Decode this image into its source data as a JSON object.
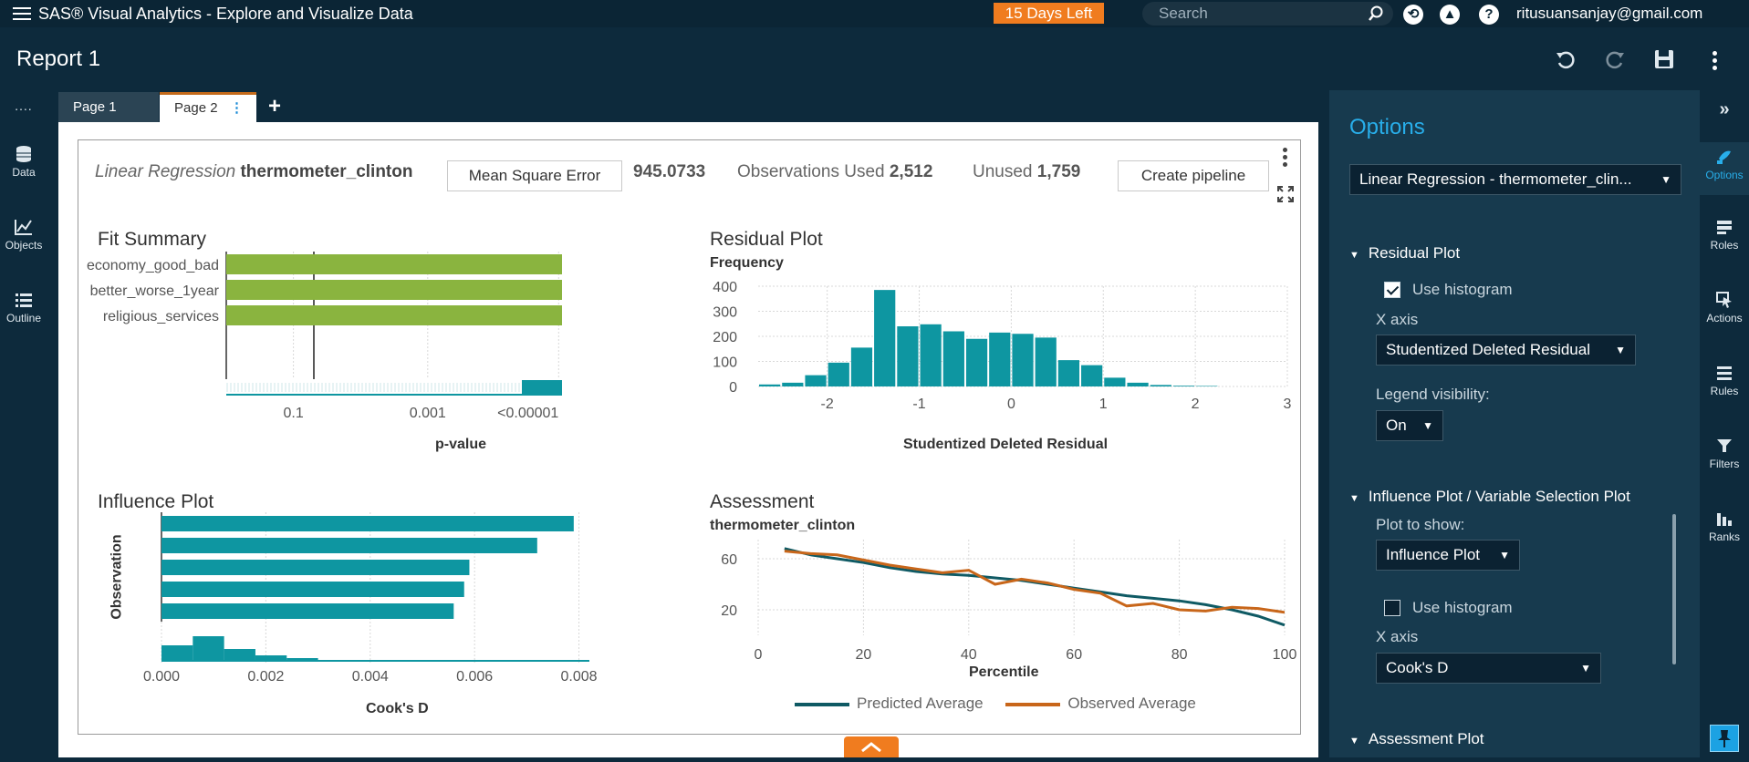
{
  "app": {
    "title": "SAS® Visual Analytics - Explore and Visualize Data",
    "trial_badge": "15 Days Left",
    "search_placeholder": "Search",
    "user_email": "ritusuansanjay@gmail.com",
    "help_icon": "?"
  },
  "report": {
    "title": "Report 1"
  },
  "left_rail": [
    {
      "label": "Data",
      "icon": "database-icon"
    },
    {
      "label": "Objects",
      "icon": "chart-line-icon"
    },
    {
      "label": "Outline",
      "icon": "list-icon"
    }
  ],
  "tabs": [
    {
      "label": "Page 1",
      "active": false
    },
    {
      "label": "Page 2",
      "active": true
    }
  ],
  "tab_add": "+",
  "object": {
    "model_type": "Linear Regression",
    "response": "thermometer_clinton",
    "metric_button": "Mean Square Error",
    "metric_value": "945.0733",
    "obs_used_label": "Observations Used",
    "obs_used_value": "2,512",
    "unused_label": "Unused",
    "unused_value": "1,759",
    "create_pipeline": "Create pipeline"
  },
  "fit_summary": {
    "title": "Fit Summary",
    "x_axis_title": "p-value",
    "variables": [
      "economy_good_bad",
      "better_worse_1year",
      "religious_services"
    ],
    "ticks": [
      "0.1",
      "0.001",
      "<0.00001"
    ],
    "bar_fraction": [
      1.0,
      1.0,
      1.0
    ]
  },
  "residual_plot": {
    "title": "Residual Plot",
    "y_label": "Frequency",
    "x_axis_title": "Studentized Deleted Residual",
    "x_ticks": [
      "-2",
      "-1",
      "0",
      "1",
      "2",
      "3"
    ],
    "y_ticks": [
      "400",
      "300",
      "200",
      "100",
      "0"
    ]
  },
  "influence_plot": {
    "title": "Influence Plot",
    "y_axis_title": "Observation",
    "x_axis_title": "Cook's D",
    "x_ticks": [
      "0.000",
      "0.002",
      "0.004",
      "0.006",
      "0.008"
    ]
  },
  "assessment": {
    "title": "Assessment",
    "subtitle": "thermometer_clinton",
    "x_axis_title": "Percentile",
    "x_ticks": [
      "0",
      "20",
      "40",
      "60",
      "80",
      "100"
    ],
    "y_ticks": [
      "60",
      "20"
    ],
    "legend": [
      "Predicted Average",
      "Observed Average"
    ],
    "colors": {
      "predicted": "#0f5a64",
      "observed": "#c8661a"
    }
  },
  "options": {
    "title": "Options",
    "object_select": "Linear Regression - thermometer_clin...",
    "residual_section": "Residual Plot",
    "use_histogram_1": "Use histogram",
    "x_axis_label_1": "X axis",
    "x_axis_value_1": "Studentized Deleted Residual",
    "legend_label": "Legend visibility:",
    "legend_value": "On",
    "influence_section": "Influence Plot / Variable Selection Plot",
    "plot_to_show_label": "Plot to show:",
    "plot_to_show_value": "Influence Plot",
    "use_histogram_2": "Use histogram",
    "x_axis_label_2": "X axis",
    "x_axis_value_2": "Cook's D",
    "assessment_section": "Assessment Plot"
  },
  "right_rail": [
    {
      "label": "Options",
      "icon": "brush-icon",
      "active": true
    },
    {
      "label": "Roles",
      "icon": "roles-icon",
      "active": false
    },
    {
      "label": "Actions",
      "icon": "cursor-icon",
      "active": false
    },
    {
      "label": "Rules",
      "icon": "rules-icon",
      "active": false
    },
    {
      "label": "Filters",
      "icon": "filter-icon",
      "active": false
    },
    {
      "label": "Ranks",
      "icon": "ranks-icon",
      "active": false
    }
  ],
  "chart_data": [
    {
      "type": "bar",
      "title": "Fit Summary",
      "xlabel": "p-value",
      "categories": [
        "economy_good_bad",
        "better_worse_1year",
        "religious_services"
      ],
      "values": [
        1e-06,
        1e-06,
        1e-06
      ],
      "xscale": "log",
      "x_ticks": [
        "0.1",
        "0.001",
        "<0.00001"
      ]
    },
    {
      "type": "bar",
      "title": "Residual Plot",
      "xlabel": "Studentized Deleted Residual",
      "ylabel": "Frequency",
      "bin_start": -2.75,
      "bin_width": 0.25,
      "values": [
        8,
        15,
        45,
        95,
        155,
        385,
        240,
        248,
        220,
        190,
        215,
        210,
        195,
        105,
        85,
        35,
        15,
        6,
        3,
        2
      ],
      "xlim": [
        -2.75,
        3
      ],
      "ylim": [
        0,
        400
      ]
    },
    {
      "type": "bar",
      "title": "Influence Plot",
      "xlabel": "Cook's D",
      "ylabel": "Observation",
      "values": [
        0.0079,
        0.0072,
        0.0059,
        0.0058,
        0.0056
      ],
      "xlim": [
        0,
        0.0082
      ]
    },
    {
      "type": "line",
      "title": "Assessment",
      "subtitle": "thermometer_clinton",
      "xlabel": "Percentile",
      "x": [
        5,
        10,
        15,
        20,
        25,
        30,
        35,
        40,
        45,
        50,
        55,
        60,
        65,
        70,
        75,
        80,
        85,
        90,
        95,
        100
      ],
      "series": [
        {
          "name": "Predicted Average",
          "values": [
            68,
            63,
            60,
            57,
            53,
            50,
            48,
            47,
            45,
            43,
            40,
            37,
            34,
            31,
            29,
            27,
            24,
            20,
            15,
            8
          ]
        },
        {
          "name": "Observed Average",
          "values": [
            66,
            64,
            63,
            59,
            55,
            52,
            49,
            51,
            40,
            44,
            41,
            36,
            33,
            23,
            25,
            20,
            19,
            22,
            21,
            18
          ]
        }
      ],
      "xlim": [
        0,
        100
      ],
      "ylim": [
        0,
        75
      ]
    }
  ]
}
